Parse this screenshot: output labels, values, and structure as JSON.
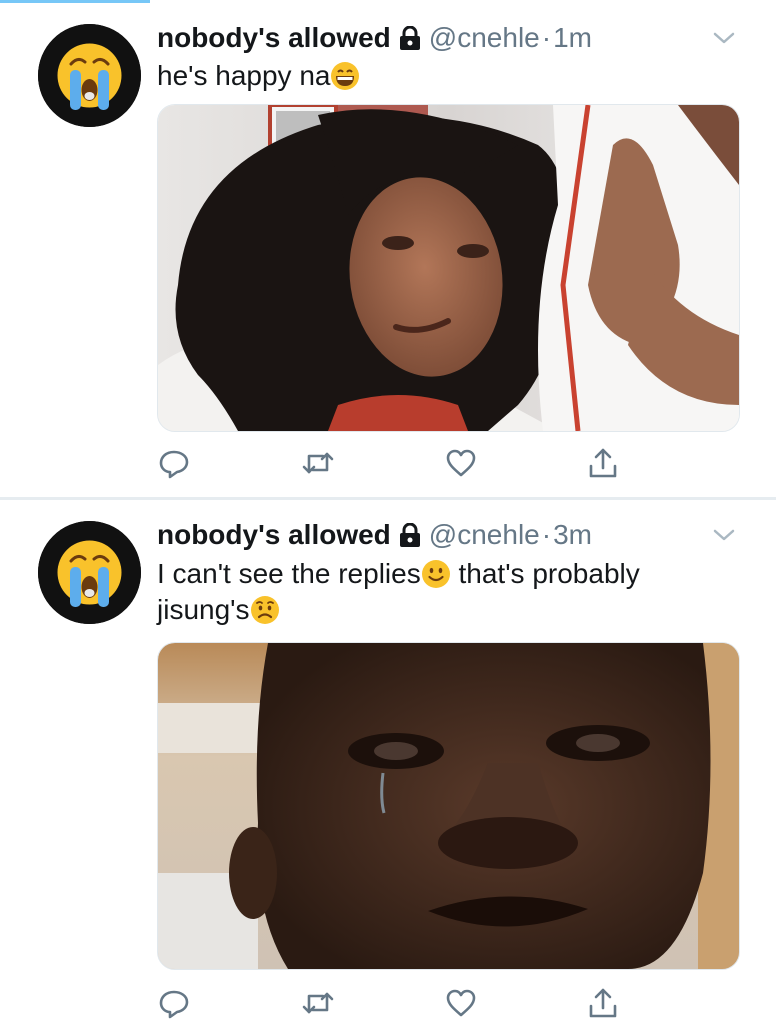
{
  "tweets": [
    {
      "name": "nobody's allowed",
      "handle": "@cnehle",
      "separator": "·",
      "time": "1m",
      "text": "he's happy na",
      "text_emoji": "grinning-face-emoji",
      "avatar_icon": "crying-face-emoji"
    },
    {
      "name": "nobody's allowed",
      "handle": "@cnehle",
      "separator": "·",
      "time": "3m",
      "text_part1": "I can't see the replies",
      "text_emoji1": "slightly-smiling-face-emoji",
      "text_part2": " that's probably",
      "text_part3": "jisung's",
      "text_emoji2": "worried-face-emoji",
      "avatar_icon": "crying-face-emoji"
    }
  ],
  "actions": [
    "reply-icon",
    "retweet-icon",
    "like-icon",
    "share-icon"
  ],
  "colors": {
    "text": "#14171a",
    "secondary": "#657786",
    "divider": "#e6ecf0",
    "icon": "#657786",
    "emoji_yellow": "#f9c22b"
  }
}
